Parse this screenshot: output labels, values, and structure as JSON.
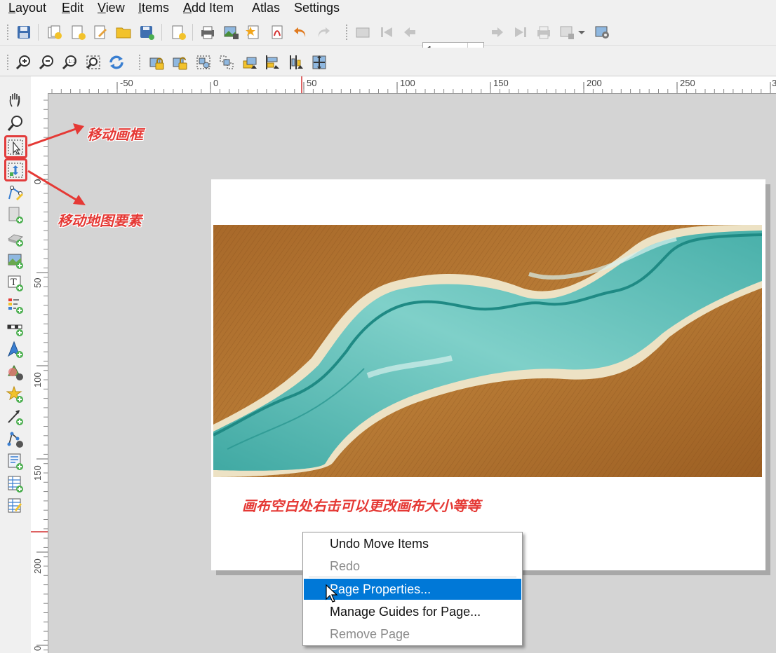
{
  "menubar": {
    "items": [
      {
        "label": "Layout",
        "u": "L",
        "rest": "ayout"
      },
      {
        "label": "Edit",
        "u": "E",
        "rest": "dit"
      },
      {
        "label": "View",
        "u": "V",
        "rest": "iew"
      },
      {
        "label": "Items",
        "u": "I",
        "rest": "tems"
      },
      {
        "label": "Add Item",
        "u": "A",
        "rest": "dd Item"
      },
      {
        "label": "Atlas",
        "u": "",
        "rest": "Atlas"
      },
      {
        "label": "Settings",
        "u": "",
        "rest": "Settings"
      }
    ]
  },
  "toolbar": {
    "atlas_page": "1"
  },
  "ruler_top": {
    "labels": [
      "-50",
      "0",
      "50",
      "100",
      "150",
      "200",
      "250",
      "3"
    ]
  },
  "ruler_left": {
    "labels": [
      "0",
      "50",
      "100",
      "150",
      "200",
      "0"
    ]
  },
  "annotations": {
    "move_frame": "移动画框",
    "move_item_content": "移动地图要素",
    "right_click_hint": "画布空白处右击可以更改画布大小等等"
  },
  "context_menu": {
    "undo": "Undo Move Items",
    "redo": "Redo",
    "page_properties": "Page Properties...",
    "manage_guides": "Manage Guides for Page...",
    "remove_page": "Remove Page"
  },
  "colors": {
    "annotation_red": "#e53935",
    "selection_blue": "#0078d7",
    "terrain_brown": "#a86a2a",
    "river_teal": "#3aa8a4"
  }
}
